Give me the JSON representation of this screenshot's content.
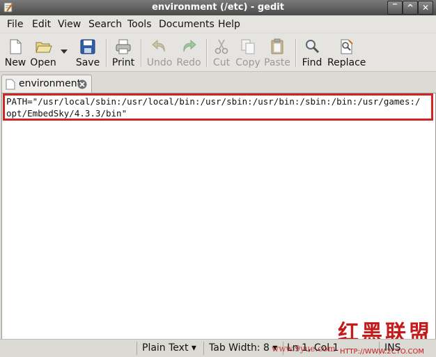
{
  "window": {
    "title": "environment (/etc) - gedit",
    "minimize": "‾",
    "maximize": "^",
    "close": "✕"
  },
  "menu": [
    "File",
    "Edit",
    "View",
    "Search",
    "Tools",
    "Documents",
    "Help"
  ],
  "toolbar": {
    "new": "New",
    "open": "Open",
    "save": "Save",
    "print": "Print",
    "undo": "Undo",
    "redo": "Redo",
    "cut": "Cut",
    "copy": "Copy",
    "paste": "Paste",
    "find": "Find",
    "replace": "Replace"
  },
  "tab": {
    "label": "environment"
  },
  "editor": {
    "lines": [
      "PATH=\"/usr/local/sbin:/usr/local/bin:/usr/sbin:/usr/bin:/sbin:/bin:/usr/games:/",
      "opt/EmbedSky/4.3.3/bin\""
    ]
  },
  "statusbar": {
    "language": "Plain Text",
    "tab_width": "Tab Width: 8",
    "position": "Ln 1, Col 1",
    "mode": "INS"
  },
  "watermark": {
    "brand": "红黑联盟",
    "url": "HTTP://WWW.2CTO.COM",
    "overlay": "www.9yue.com"
  },
  "colors": {
    "highlight": "#d32424",
    "titlebar": "#5a5a5a"
  }
}
